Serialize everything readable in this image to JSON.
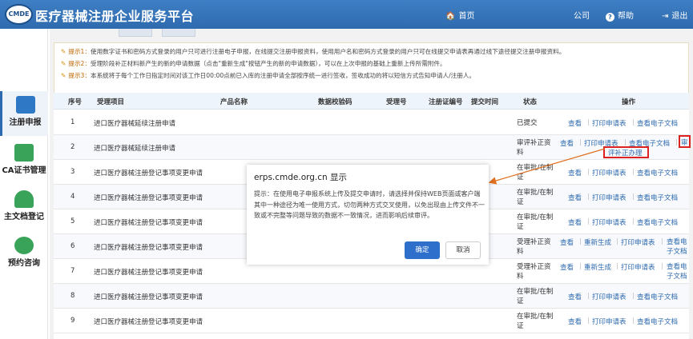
{
  "header": {
    "logo_text": "CMDE",
    "title": "医疗器械注册企业服务平台",
    "nav": {
      "home": "首页",
      "company": "公司",
      "help": "帮助",
      "exit": "退出"
    }
  },
  "sidebar": {
    "items": [
      {
        "label": "注册申报",
        "icon": "document-edit-icon"
      },
      {
        "label": "CA证书管理",
        "icon": "ca-card-icon"
      },
      {
        "label": "主文档登记",
        "icon": "people-icon"
      },
      {
        "label": "预约咨询",
        "icon": "chat-person-icon"
      }
    ]
  },
  "notice": {
    "lines": [
      {
        "label": "提示1：",
        "text": "使用数字证书和密码方式登录的用户只可进行注册电子申报，在线提交注册申报资料，使用用户名和密码方式登录的用户只可在线提交申请表再通过线下途径提交注册申报资料。"
      },
      {
        "label": "提示2：",
        "text": "受理阶段补正材料新产生的新的申请数据（点击\"重新生成\"按钮产生的新的申请数据），可以在上次申报的基础上重新上传所需附件。"
      },
      {
        "label": "提示3：",
        "text": "本系统将于每个工作日指定时间对该工作日00:00点前已入库的注册申请全部按序统一进行签收，签收成功的将以短信方式告知申请人/注册人。"
      }
    ]
  },
  "table": {
    "headers": [
      "序号",
      "受理项目",
      "产品名称",
      "数据校验码",
      "受理号",
      "注册证编号",
      "提交时间",
      "状态",
      "操作"
    ],
    "rows": [
      {
        "no": "1",
        "project": "进口医疗器械延续注册申请",
        "status": "已提交",
        "ops": [
          "查看",
          "打印申请表",
          "查看电子文档"
        ]
      },
      {
        "no": "2",
        "project": "进口医疗器械延续注册申请",
        "status": "审评补正资料",
        "ops": [
          "查看",
          "打印申请表",
          "查看电子文档",
          "审",
          "评补正办理"
        ]
      },
      {
        "no": "3",
        "project": "进口医疗器械注册登记事项变更申请",
        "status": "在审批/在制证",
        "ops": [
          "查看",
          "打印申请表",
          "查看电子文档"
        ]
      },
      {
        "no": "4",
        "project": "进口医疗器械注册登记事项变更申请",
        "status": "在审批/在制证",
        "ops": [
          "查看",
          "打印申请表",
          "查看电子文档"
        ]
      },
      {
        "no": "5",
        "project": "进口医疗器械注册登记事项变更申请",
        "status": "在审批/在制证",
        "ops": [
          "查看",
          "打印申请表",
          "查看电子文档"
        ]
      },
      {
        "no": "6",
        "project": "进口医疗器械注册登记事项变更申请",
        "status": "受理补正资料",
        "ops": [
          "查看",
          "重新生成",
          "打印申请表",
          "查看电子文档"
        ]
      },
      {
        "no": "7",
        "project": "进口医疗器械注册登记事项变更申请",
        "status": "受理补正资料",
        "ops": [
          "查看",
          "重新生成",
          "打印申请表",
          "查看电子文档"
        ]
      },
      {
        "no": "8",
        "project": "进口医疗器械注册登记事项变更申请",
        "status": "在审批/在制证",
        "ops": [
          "查看",
          "打印申请表",
          "查看电子文档"
        ]
      },
      {
        "no": "9",
        "project": "进口医疗器械注册登记事项变更申请",
        "status": "在审批/在制证",
        "ops": [
          "查看",
          "打印申请表",
          "查看电子文档"
        ]
      }
    ]
  },
  "dialog": {
    "title": "erps.cmde.org.cn 显示",
    "message": "提示：在使用电子申报系统上传及提交申请时，请选择并保持WEB页面或客户端其中一种途径为唯一使用方式，切勿两种方式交叉使用，以免出现由上传文件不一致或不完整等问题导致的数据不一致情况，进而影响后续审评。",
    "ok_label": "确定",
    "cancel_label": "取消"
  },
  "colors": {
    "header_bg": "#2e6aae",
    "link": "#2e6aae",
    "highlight_box": "#dd2222"
  }
}
